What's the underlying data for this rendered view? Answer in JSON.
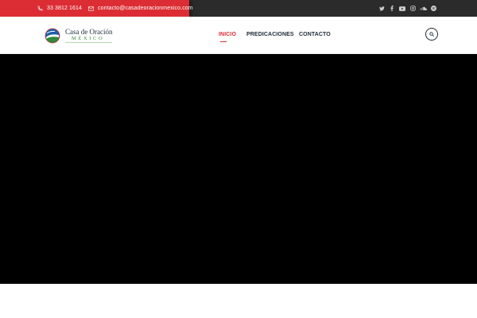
{
  "topbar": {
    "phone": "33 3812 1614",
    "email": "contacto@casadeoracionmexico.com",
    "phone_icon": "phone-icon",
    "email_icon": "envelope-icon",
    "social_icons": [
      "twitter-icon",
      "facebook-icon",
      "youtube-icon",
      "instagram-icon",
      "soundcloud-icon",
      "spotify-icon"
    ],
    "colors": {
      "accent": "#dc2d34",
      "dark": "#2b2b2b"
    }
  },
  "header": {
    "logo": {
      "line1": "Casa de Oración",
      "line2": "MÉXICO"
    },
    "nav": [
      {
        "label": "INICIO",
        "active": true
      },
      {
        "label": "PREDICACIONES",
        "active": false
      },
      {
        "label": "CONTACTO",
        "active": false
      }
    ],
    "search_icon": "search-icon"
  },
  "hero": {
    "background": "#000000"
  }
}
